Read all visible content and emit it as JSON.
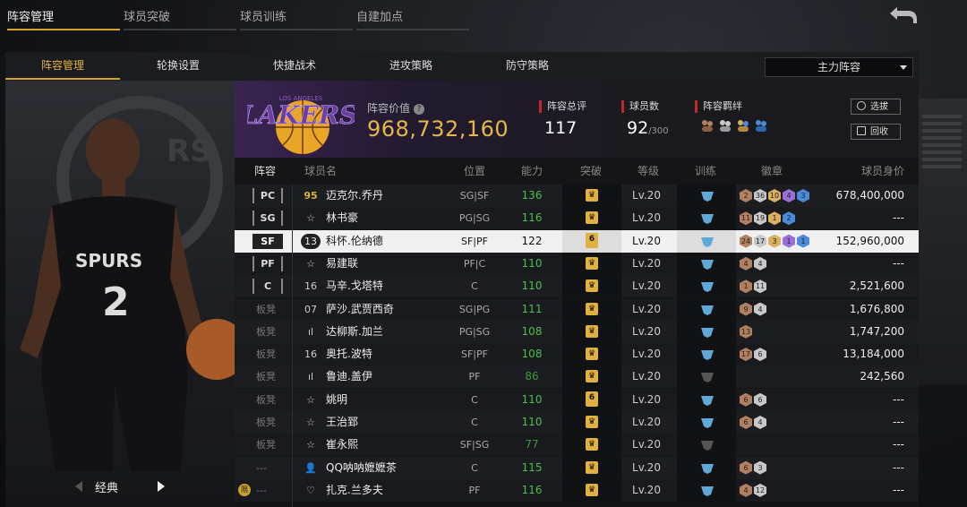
{
  "top_tabs": [
    {
      "label": "阵容管理",
      "active": true
    },
    {
      "label": "球员突破",
      "active": false
    },
    {
      "label": "球员训练",
      "active": false
    },
    {
      "label": "自建加点",
      "active": false
    }
  ],
  "sub_tabs": [
    {
      "label": "阵容管理",
      "active": true
    },
    {
      "label": "轮换设置",
      "active": false
    },
    {
      "label": "快捷战术",
      "active": false
    },
    {
      "label": "进攻策略",
      "active": false
    },
    {
      "label": "防守策略",
      "active": false
    }
  ],
  "lineup_select": {
    "value": "主力阵容"
  },
  "player_pane": {
    "style_label": "经典"
  },
  "team": {
    "logo_text": "LAKERS",
    "logo_subtext": "LOS ANGELES",
    "value_label": "阵容价值",
    "value": "968,732,160",
    "stats": [
      {
        "label": "阵容总评",
        "value": "117",
        "suffix": ""
      },
      {
        "label": "球员数",
        "value": "92",
        "suffix": "/300"
      },
      {
        "label": "阵容羁绊",
        "value": "",
        "suffix": ""
      }
    ],
    "buttons": {
      "select": "选拔",
      "recycle": "回收"
    }
  },
  "table": {
    "headers": [
      "阵容",
      "球员名",
      "位置",
      "能力",
      "突破",
      "等级",
      "训练",
      "徽章",
      "球员身价"
    ],
    "rows": [
      {
        "slot": "PC",
        "bench": false,
        "ovr": "95",
        "ovr_style": "gold",
        "name": "迈克尔.乔丹",
        "position": "SG|SF",
        "ability": "136",
        "ability_color": "#4cbf4c",
        "breakthrough": "",
        "level": "Lv.20",
        "training": "on",
        "badges": [
          {
            "n": "2",
            "c": "#b08060"
          },
          {
            "n": "36",
            "c": "#c8c8c8"
          },
          {
            "n": "10",
            "c": "#d8b060"
          },
          {
            "n": "4",
            "c": "#9a70d8"
          },
          {
            "n": "3",
            "c": "#4a8ad8"
          }
        ],
        "worth": "678,400,000"
      },
      {
        "slot": "SG",
        "bench": false,
        "ovr": "☆",
        "ovr_style": "star",
        "name": "林书豪",
        "position": "PG|SG",
        "ability": "116",
        "ability_color": "#4cbf4c",
        "breakthrough": "",
        "level": "Lv.20",
        "training": "on",
        "badges": [
          {
            "n": "11",
            "c": "#b08060"
          },
          {
            "n": "19",
            "c": "#c8c8c8"
          },
          {
            "n": "1",
            "c": "#d8b060"
          },
          {
            "n": "2",
            "c": "#4a8ad8"
          }
        ],
        "worth": "---"
      },
      {
        "slot": "SF",
        "bench": false,
        "selected": true,
        "ovr": "13",
        "ovr_style": "dark",
        "name": "科怀.伦纳德",
        "position": "SF|PF",
        "ability": "122",
        "ability_color": "#111111",
        "breakthrough": "6",
        "level": "Lv.20",
        "training": "on",
        "badges": [
          {
            "n": "24",
            "c": "#b08060"
          },
          {
            "n": "17",
            "c": "#c8c8c8"
          },
          {
            "n": "3",
            "c": "#d8b060"
          },
          {
            "n": "1",
            "c": "#9a70d8"
          },
          {
            "n": "1",
            "c": "#4a8ad8"
          }
        ],
        "worth": "152,960,000"
      },
      {
        "slot": "PF",
        "bench": false,
        "ovr": "☆",
        "ovr_style": "star",
        "name": "易建联",
        "position": "PF|C",
        "ability": "110",
        "ability_color": "#4cbf4c",
        "breakthrough": "",
        "level": "Lv.20",
        "training": "on",
        "badges": [
          {
            "n": "4",
            "c": "#b08060"
          },
          {
            "n": "4",
            "c": "#c8c8c8"
          }
        ],
        "worth": "---"
      },
      {
        "slot": "C",
        "bench": false,
        "ovr": "16",
        "ovr_style": "plain",
        "name": "马辛.戈塔特",
        "position": "C",
        "ability": "110",
        "ability_color": "#4cbf4c",
        "breakthrough": "",
        "level": "Lv.20",
        "training": "on",
        "badges": [
          {
            "n": "1",
            "c": "#b08060"
          },
          {
            "n": "11",
            "c": "#c8c8c8"
          }
        ],
        "worth": "2,521,600"
      },
      {
        "slot": "板凳",
        "bench": true,
        "ovr": "07",
        "ovr_style": "plain",
        "name": "萨沙.武贾西奇",
        "position": "SG|PG",
        "ability": "111",
        "ability_color": "#4cbf4c",
        "breakthrough": "",
        "level": "Lv.20",
        "training": "on",
        "badges": [
          {
            "n": "9",
            "c": "#b08060"
          },
          {
            "n": "4",
            "c": "#c8c8c8"
          }
        ],
        "worth": "1,676,800"
      },
      {
        "slot": "板凳",
        "bench": true,
        "ovr": "ıl",
        "ovr_style": "plain",
        "name": "达柳斯.加兰",
        "position": "PG|SG",
        "ability": "108",
        "ability_color": "#4cbf4c",
        "breakthrough": "",
        "level": "Lv.20",
        "training": "on",
        "badges": [
          {
            "n": "13",
            "c": "#b08060"
          }
        ],
        "worth": "1,747,200"
      },
      {
        "slot": "板凳",
        "bench": true,
        "ovr": "16",
        "ovr_style": "plain",
        "name": "奥托.波特",
        "position": "SF|PF",
        "ability": "108",
        "ability_color": "#4cbf4c",
        "breakthrough": "",
        "level": "Lv.20",
        "training": "on",
        "badges": [
          {
            "n": "17",
            "c": "#b08060"
          },
          {
            "n": "6",
            "c": "#c8c8c8"
          }
        ],
        "worth": "13,184,000"
      },
      {
        "slot": "板凳",
        "bench": true,
        "ovr": "ıl",
        "ovr_style": "plain",
        "name": "鲁迪.盖伊",
        "position": "PF",
        "ability": "86",
        "ability_color": "#3a9a3a",
        "breakthrough": "",
        "level": "Lv.20",
        "training": "off",
        "badges": [],
        "worth": "242,560"
      },
      {
        "slot": "板凳",
        "bench": true,
        "ovr": "☆",
        "ovr_style": "star",
        "name": "姚明",
        "position": "C",
        "ability": "110",
        "ability_color": "#4cbf4c",
        "breakthrough": "6",
        "level": "Lv.20",
        "training": "on",
        "badges": [
          {
            "n": "6",
            "c": "#b08060"
          },
          {
            "n": "6",
            "c": "#c8c8c8"
          }
        ],
        "worth": "---"
      },
      {
        "slot": "板凳",
        "bench": true,
        "ovr": "☆",
        "ovr_style": "star",
        "name": "王治郅",
        "position": "C",
        "ability": "110",
        "ability_color": "#4cbf4c",
        "breakthrough": "",
        "level": "Lv.20",
        "training": "on",
        "badges": [
          {
            "n": "6",
            "c": "#b08060"
          },
          {
            "n": "4",
            "c": "#c8c8c8"
          }
        ],
        "worth": "---"
      },
      {
        "slot": "板凳",
        "bench": true,
        "ovr": "☆",
        "ovr_style": "star",
        "name": "崔永熙",
        "position": "SF|SG",
        "ability": "77",
        "ability_color": "#3a9a3a",
        "breakthrough": "",
        "level": "Lv.20",
        "training": "off",
        "badges": [],
        "worth": "---"
      },
      {
        "slot": "---",
        "bench": true,
        "ovr": "👤",
        "ovr_style": "plain",
        "name": "QQ呐呐嬷嬷茶",
        "position": "C",
        "ability": "115",
        "ability_color": "#4cbf4c",
        "breakthrough": "",
        "level": "Lv.20",
        "training": "on",
        "badges": [
          {
            "n": "6",
            "c": "#b08060"
          },
          {
            "n": "3",
            "c": "#c8c8c8"
          }
        ],
        "worth": "---"
      },
      {
        "slot": "---",
        "bench": true,
        "coin": "限",
        "ovr": "♡",
        "ovr_style": "plain",
        "name": "扎克.兰多夫",
        "position": "PF",
        "ability": "116",
        "ability_color": "#4cbf4c",
        "breakthrough": "",
        "level": "Lv.20",
        "training": "on",
        "badges": [
          {
            "n": "4",
            "c": "#b08060"
          },
          {
            "n": "12",
            "c": "#c8c8c8"
          }
        ],
        "worth": "---"
      }
    ]
  }
}
